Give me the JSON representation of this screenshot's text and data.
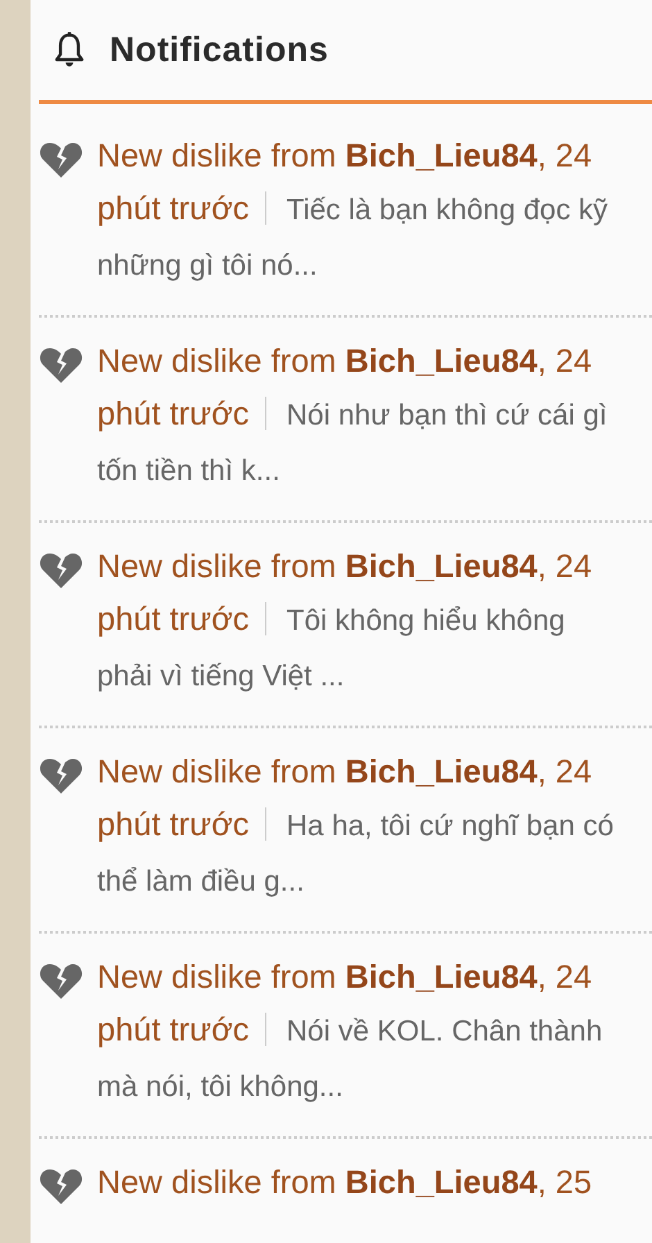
{
  "header": {
    "title": "Notifications"
  },
  "notifications": [
    {
      "title": "New dislike from **Bich_Lieu84**, 24 phút trước",
      "snippet": "Tiếc là bạn không đọc kỹ những gì tôi nó..."
    },
    {
      "title": "New dislike from **Bich_Lieu84**, 24 phút trước",
      "snippet": "Nói như bạn thì cứ cái gì tốn tiền thì k..."
    },
    {
      "title": "New dislike from **Bich_Lieu84**, 24 phút trước",
      "snippet": "Tôi không hiểu không phải vì tiếng Việt ..."
    },
    {
      "title": "New dislike from **Bich_Lieu84**, 24 phút trước",
      "snippet": "Ha ha, tôi cứ nghĩ bạn có thể làm điều g..."
    },
    {
      "title": "New dislike from **Bich_Lieu84**, 24 phút trước",
      "snippet": "Nói về KOL. Chân thành mà nói, tôi không..."
    },
    {
      "title": "New dislike from **Bich_Lieu84**, 25"
    }
  ]
}
